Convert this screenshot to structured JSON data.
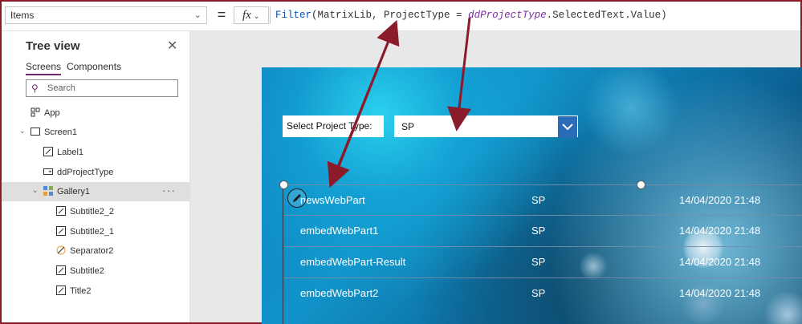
{
  "formula_bar": {
    "property": "Items",
    "equals": "=",
    "fx": "fx",
    "formula_parts": {
      "fn": "Filter",
      "open": "(MatrixLib, ProjectType = ",
      "control": "ddProjectType",
      "rest": ".SelectedText.Value)"
    }
  },
  "tree_view": {
    "title": "Tree view",
    "tabs": [
      "Screens",
      "Components"
    ],
    "search_placeholder": "Search",
    "nodes": {
      "app": "App",
      "screen1": "Screen1",
      "label1": "Label1",
      "ddprojecttype": "ddProjectType",
      "gallery1": "Gallery1",
      "subtitle2_2": "Subtitle2_2",
      "subtitle2_1": "Subtitle2_1",
      "separator2": "Separator2",
      "subtitle2": "Subtitle2",
      "title2": "Title2"
    },
    "more": "···"
  },
  "app": {
    "label": "Select Project Type:",
    "dropdown_value": "SP",
    "rows": [
      {
        "title": "newsWebPart",
        "type": "SP",
        "date": "14/04/2020 21:48"
      },
      {
        "title": "embedWebPart1",
        "type": "SP",
        "date": "14/04/2020 21:48"
      },
      {
        "title": "embedWebPart-Result",
        "type": "SP",
        "date": "14/04/2020 21:48"
      },
      {
        "title": "embedWebPart2",
        "type": "SP",
        "date": "14/04/2020 21:48"
      }
    ]
  },
  "colors": {
    "accent": "#742774",
    "arrow": "#8b1a2b",
    "dropdown_button": "#2b6cb8"
  }
}
